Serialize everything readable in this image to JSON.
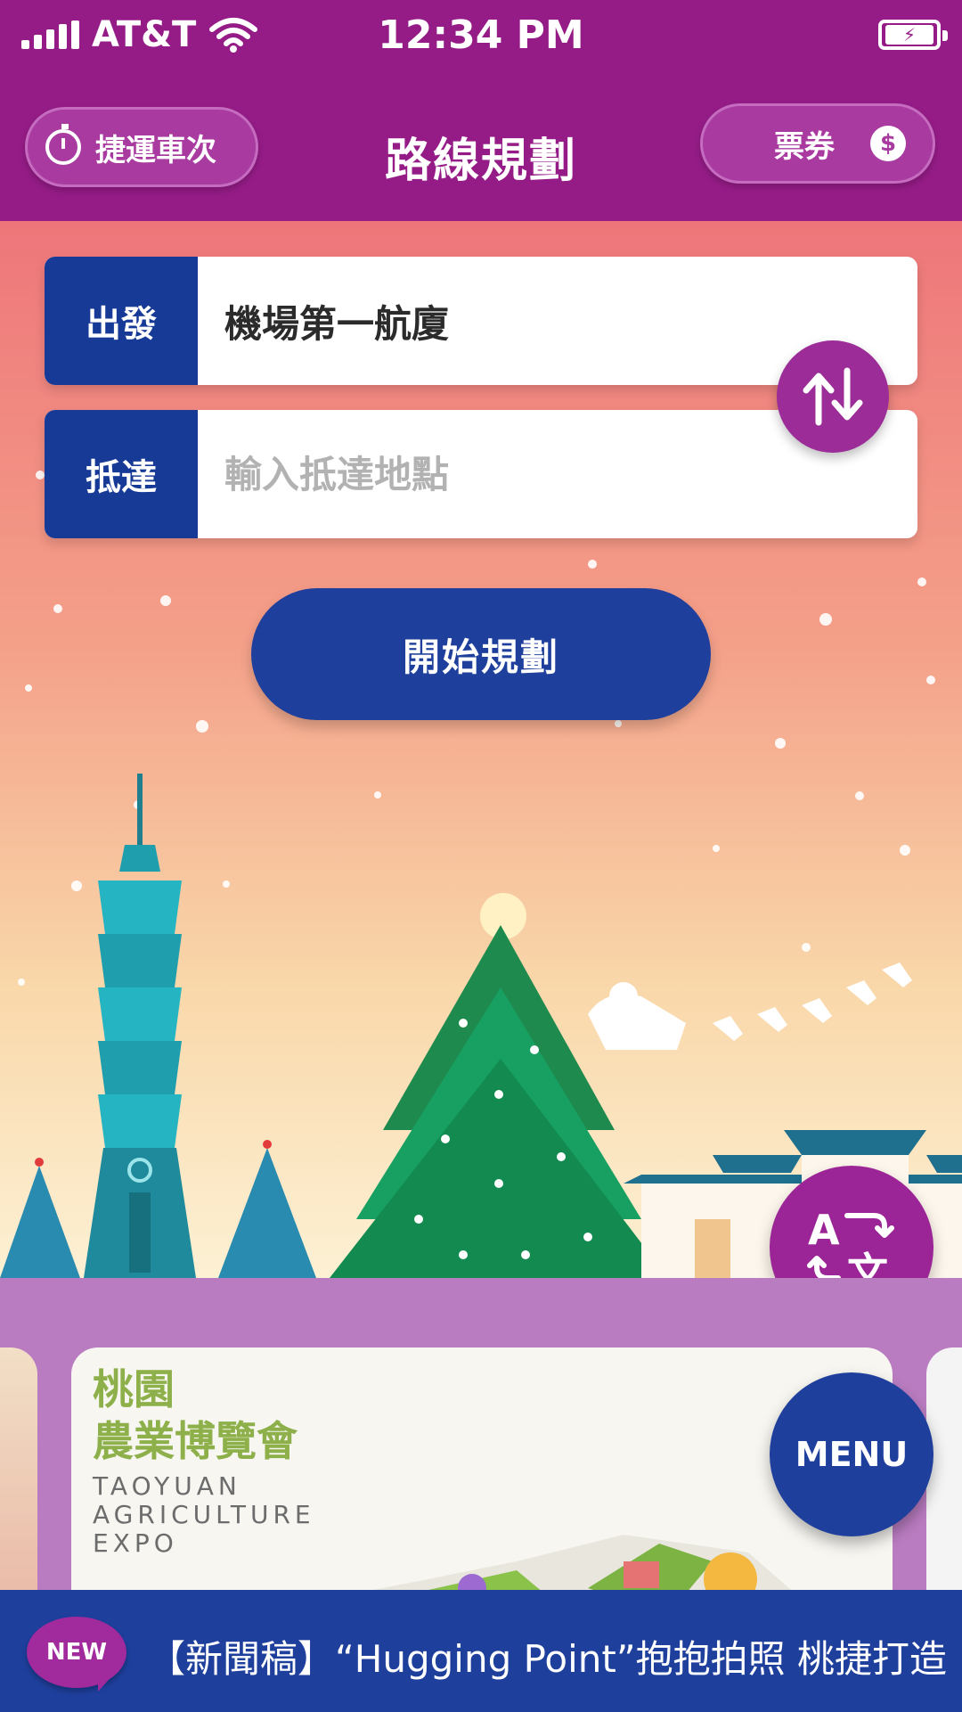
{
  "status_bar": {
    "carrier": "AT&T",
    "time": "12:34 PM"
  },
  "header": {
    "title": "路線規劃",
    "schedule_label": "捷運車次",
    "ticket_label": "票券",
    "ticket_icon_glyph": "$"
  },
  "route_form": {
    "from_label": "出發",
    "from_value": "機場第一航廈",
    "to_label": "抵達",
    "to_placeholder": "輸入抵達地點",
    "plan_button": "開始規劃"
  },
  "translate_button": {
    "icon": "translate-icon"
  },
  "banner": {
    "card_title_zh_line1": "桃園",
    "card_title_zh_line2": "農業博覽會",
    "card_title_en_line1": "TAOYUAN",
    "card_title_en_line2": "AGRICULTURE",
    "card_title_en_line3": "EXPO"
  },
  "menu_button": {
    "label": "MENU"
  },
  "news": {
    "badge": "NEW",
    "headline": "【新聞稿】“Hugging Point”抱抱拍照 桃捷打造"
  },
  "colors": {
    "header": "#951c87",
    "navy": "#1e3f9c",
    "label_navy": "#173a97",
    "magenta_button": "#9b2496",
    "banner_strip": "#b97cc0"
  }
}
